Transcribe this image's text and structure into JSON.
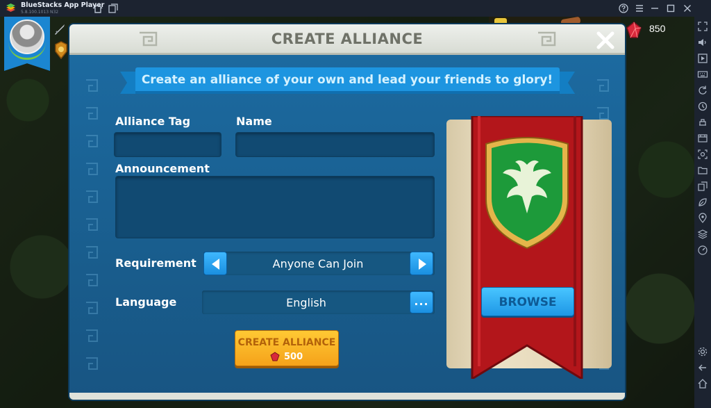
{
  "window": {
    "app_title": "BlueStacks App Player",
    "version": "5.8.100.1013  N32"
  },
  "hud": {
    "gem_count": "850"
  },
  "dialog": {
    "title": "CREATE ALLIANCE",
    "subtitle": "Create an alliance of your own and lead your friends to glory!",
    "alliance_tag_label": "Alliance Tag",
    "alliance_tag_value": "",
    "name_label": "Name",
    "name_value": "",
    "announcement_label": "Announcement",
    "announcement_value": "",
    "requirement_label": "Requirement",
    "requirement_value": "Anyone Can Join",
    "language_label": "Language",
    "language_value": "English",
    "more_label": "...",
    "create_button_label": "CREATE ALLIANCE",
    "create_button_cost": "500",
    "browse_button_label": "BROWSE"
  },
  "colors": {
    "dialog_blue": "#1c6aa0",
    "create_button": "#f5a21a",
    "browse_button": "#1e97e6",
    "banner_red": "#b3161b",
    "crest_green": "#1d9a3a"
  },
  "icons": {
    "titlebar": [
      "bluestacks-logo-icon",
      "home-icon",
      "multi-instance-icon",
      "help-icon",
      "menu-icon",
      "minimize-icon",
      "maximize-icon",
      "close-icon"
    ],
    "sidebar": [
      "fullscreen-icon",
      "volume-icon",
      "screen-record-icon",
      "keyboard-icon",
      "rotate-icon",
      "sync-icon",
      "build-apk-icon",
      "media-folder-icon",
      "screenshot-icon",
      "folder-icon",
      "copy-icon",
      "eco-mode-icon",
      "location-icon",
      "layers-icon",
      "speed-icon",
      "settings-icon",
      "back-icon",
      "home-icon"
    ]
  }
}
